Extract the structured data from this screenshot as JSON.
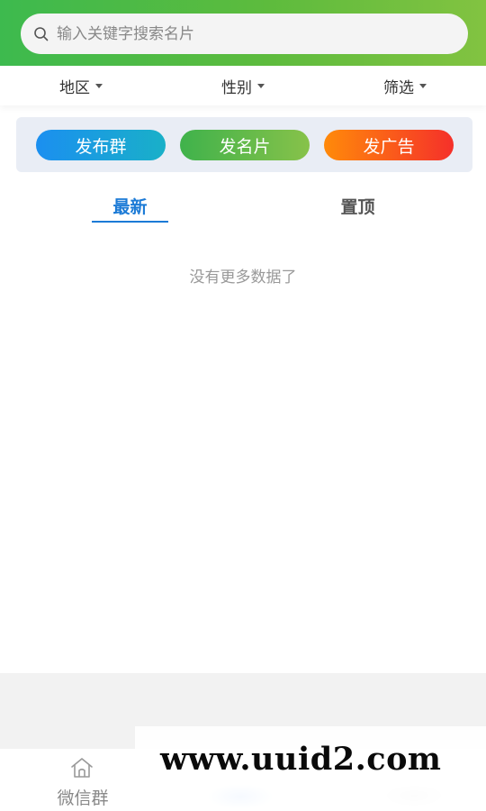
{
  "search": {
    "placeholder": "输入关键字搜索名片",
    "value": ""
  },
  "filters": [
    {
      "label": "地区"
    },
    {
      "label": "性别"
    },
    {
      "label": "筛选"
    }
  ],
  "actions": {
    "publish_group": "发布群",
    "publish_card": "发名片",
    "publish_ad": "发广告"
  },
  "tabs": [
    {
      "label": "最新",
      "active": true
    },
    {
      "label": "置顶",
      "active": false
    }
  ],
  "list": {
    "empty_text": "没有更多数据了"
  },
  "bottom_nav": [
    {
      "label": "微信群",
      "icon": "home-icon"
    }
  ],
  "watermark": "www.uuid2.com",
  "colors": {
    "header_gradient_start": "#3dba4e",
    "header_gradient_end": "#82c341",
    "tab_active": "#1b7ad6",
    "btn_group_start": "#1b8ff0",
    "btn_card_start": "#3fb24b",
    "btn_ad_start": "#ff8a0a",
    "btn_ad_end": "#f5302a"
  }
}
